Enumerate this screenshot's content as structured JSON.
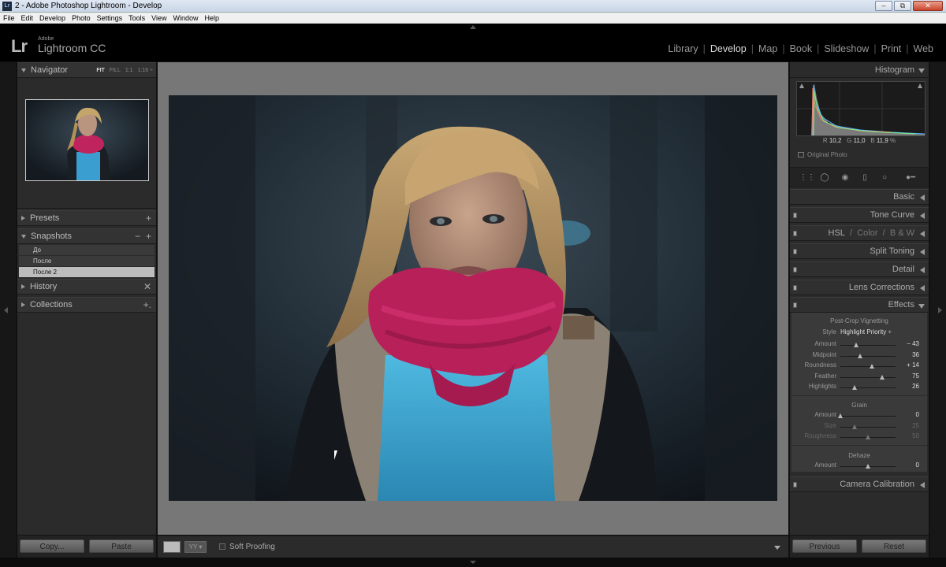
{
  "window": {
    "title": "2 - Adobe Photoshop Lightroom - Develop",
    "app_icon": "Lr",
    "minimize": "‒",
    "maximize": "⧉",
    "close": "✕"
  },
  "menu": [
    "File",
    "Edit",
    "Develop",
    "Photo",
    "Settings",
    "Tools",
    "View",
    "Window",
    "Help"
  ],
  "logo": {
    "mark": "Lr",
    "adobe": "Adobe",
    "name": "Lightroom CC"
  },
  "modules": [
    {
      "label": "Library",
      "active": false
    },
    {
      "label": "Develop",
      "active": true
    },
    {
      "label": "Map",
      "active": false
    },
    {
      "label": "Book",
      "active": false
    },
    {
      "label": "Slideshow",
      "active": false
    },
    {
      "label": "Print",
      "active": false
    },
    {
      "label": "Web",
      "active": false
    }
  ],
  "left_panel": {
    "navigator": {
      "label": "Navigator",
      "options": [
        "FIT",
        "FILL",
        "1:1",
        "1:16 ÷"
      ],
      "active_option": "FIT"
    },
    "presets": {
      "label": "Presets",
      "plus": "+"
    },
    "snapshots": {
      "label": "Snapshots",
      "minus": "−",
      "plus": "+",
      "items": [
        {
          "label": "До",
          "selected": false
        },
        {
          "label": "После",
          "selected": false
        },
        {
          "label": "После 2",
          "selected": true
        }
      ]
    },
    "history": {
      "label": "History",
      "close": "✕"
    },
    "collections": {
      "label": "Collections",
      "plus": "+."
    }
  },
  "left_footer": {
    "copy": "Copy...",
    "paste": "Paste"
  },
  "right_panel": {
    "histogram": {
      "label": "Histogram",
      "readout": {
        "r_label": "R",
        "r": "10,2",
        "g_label": "G",
        "g": "11,0",
        "b_label": "B",
        "b": "11,9",
        "unit": "%"
      },
      "original_photo": "Original Photo"
    },
    "panels": [
      {
        "label": "Basic"
      },
      {
        "label": "Tone Curve"
      },
      {
        "hsl": "HSL",
        "sep": "/",
        "color": "Color",
        "bw": "B & W"
      },
      {
        "label": "Split Toning"
      },
      {
        "label": "Detail"
      },
      {
        "label": "Lens Corrections"
      },
      {
        "label": "Effects"
      },
      {
        "label": "Camera Calibration"
      }
    ],
    "effects": {
      "vignette_title": "Post-Crop Vignetting",
      "style_label": "Style",
      "style_value": "Highlight Priority ÷",
      "vignette": [
        {
          "label": "Amount",
          "value": "− 43",
          "pos": 0.285
        },
        {
          "label": "Midpoint",
          "value": "36",
          "pos": 0.36
        },
        {
          "label": "Roundness",
          "value": "+ 14",
          "pos": 0.57
        },
        {
          "label": "Feather",
          "value": "75",
          "pos": 0.75
        },
        {
          "label": "Highlights",
          "value": "26",
          "pos": 0.26
        }
      ],
      "grain_title": "Grain",
      "grain": [
        {
          "label": "Amount",
          "value": "0",
          "pos": 0.0,
          "dim": false
        },
        {
          "label": "Size",
          "value": "25",
          "pos": 0.25,
          "dim": true
        },
        {
          "label": "Roughness",
          "value": "50",
          "pos": 0.5,
          "dim": true
        }
      ],
      "dehaze_title": "Dehaze",
      "dehaze": [
        {
          "label": "Amount",
          "value": "0",
          "pos": 0.5,
          "dim": false
        }
      ]
    }
  },
  "right_footer": {
    "previous": "Previous",
    "reset": "Reset"
  },
  "toolbar": {
    "view_yy": "YY ▾",
    "soft_proofing": "Soft Proofing"
  }
}
